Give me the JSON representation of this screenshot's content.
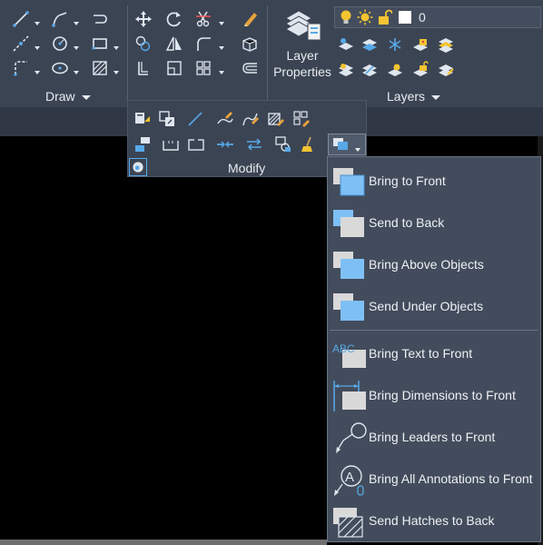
{
  "ribbon": {
    "draw_panel_label": "Draw",
    "layers_panel_label": "Layers",
    "modify_panel_label": "Modify",
    "layer_properties_line1": "Layer",
    "layer_properties_line2": "Properties",
    "current_layer_value": "0"
  },
  "arrange_menu": {
    "items": [
      {
        "label": "Bring to Front",
        "icon": "bring-to-front-icon"
      },
      {
        "label": "Send to Back",
        "icon": "send-to-back-icon"
      },
      {
        "label": "Bring Above Objects",
        "icon": "bring-above-objects-icon"
      },
      {
        "label": "Send Under Objects",
        "icon": "send-under-objects-icon"
      },
      {
        "label": "Bring Text to Front",
        "icon": "bring-text-to-front-icon"
      },
      {
        "label": "Bring Dimensions to Front",
        "icon": "bring-dimensions-to-front-icon"
      },
      {
        "label": "Bring Leaders to Front",
        "icon": "bring-leaders-to-front-icon"
      },
      {
        "label": "Bring All Annotations to Front",
        "icon": "bring-all-annotations-to-front-icon"
      },
      {
        "label": "Send Hatches to Back",
        "icon": "send-hatches-to-back-icon"
      }
    ]
  },
  "colors": {
    "ribbon_bg": "#3b4453",
    "menu_bg": "#434c5c",
    "accent_blue": "#58a9e8",
    "icon_gray": "#dcdcdc",
    "lightbulb_yellow": "#f4c430"
  }
}
